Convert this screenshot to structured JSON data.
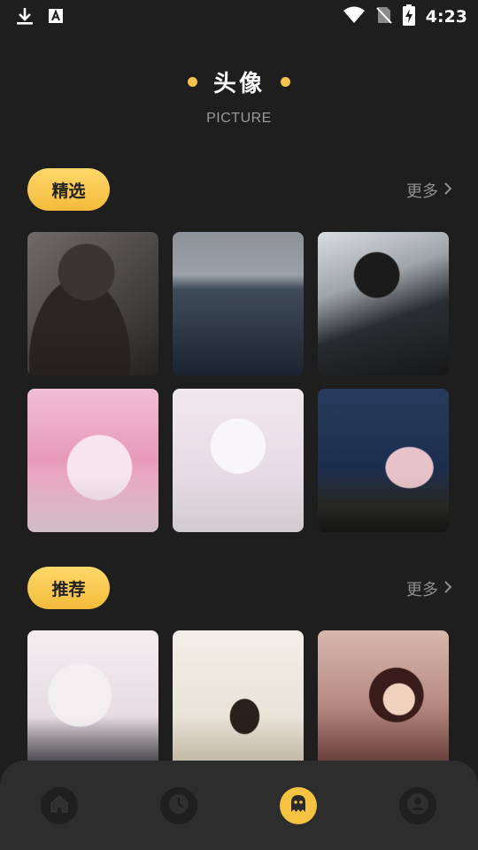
{
  "status_bar": {
    "time": "4:23",
    "left_icons": [
      "download-icon",
      "text-a-icon"
    ],
    "right_icons": [
      "wifi-icon",
      "no-sim-icon",
      "battery-charging-icon"
    ]
  },
  "header": {
    "title": "头像",
    "subtitle": "PICTURE"
  },
  "sections": [
    {
      "label": "精选",
      "more": "更多",
      "items": [
        "photo-boy-mirror",
        "photo-couple-sea",
        "photo-boy-car",
        "anime-pink-girl",
        "anime-white-girl",
        "photo-boy-lake"
      ]
    },
    {
      "label": "推荐",
      "more": "更多",
      "items": [
        "anime-hug",
        "photo-girl-wall",
        "anime-warrior"
      ]
    }
  ],
  "bottom_nav": {
    "items": [
      "home-icon",
      "clock-icon",
      "ghost-icon",
      "profile-icon"
    ],
    "active_index": 2
  },
  "colors": {
    "background": "#1e1e1e",
    "accent": "#f4c24d",
    "nav_background": "#2d2d2d",
    "muted_text": "#8e8e8e"
  }
}
